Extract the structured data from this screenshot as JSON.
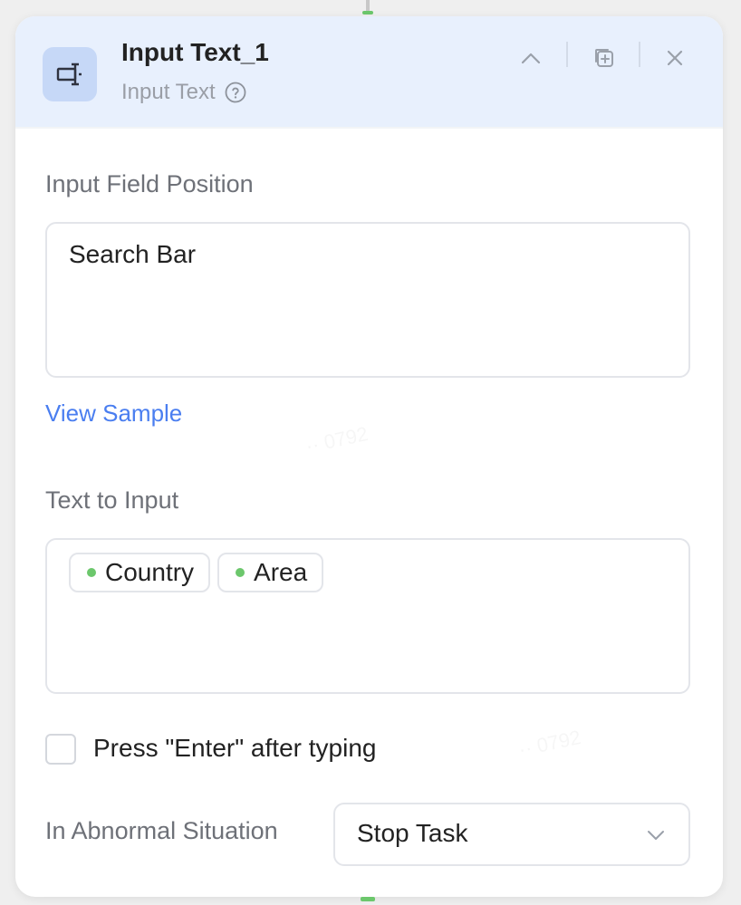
{
  "node": {
    "title": "Input Text_1",
    "subtitle": "Input Text",
    "icon": "input-text-icon"
  },
  "header_actions": {
    "collapse_icon": "chevron-up-icon",
    "copy_icon": "copy-add-icon",
    "close_icon": "close-icon"
  },
  "input_field_position": {
    "label": "Input Field Position",
    "value": "Search Bar",
    "link": "View Sample"
  },
  "text_to_input": {
    "label": "Text to Input",
    "tags": [
      "Country",
      "Area"
    ]
  },
  "press_enter": {
    "label": "Press \"Enter\" after typing",
    "checked": false
  },
  "abnormal": {
    "label": "In Abnormal Situation",
    "value": "Stop Task"
  },
  "colors": {
    "header_bg": "#e8f0fd",
    "link": "#4a7ef0",
    "tag_dot": "#6cc76c"
  }
}
